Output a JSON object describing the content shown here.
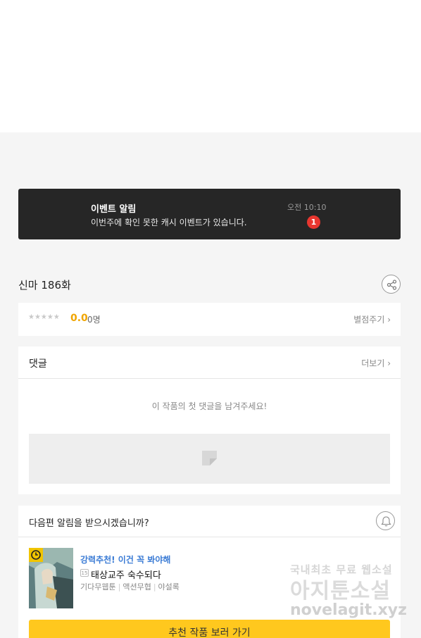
{
  "event": {
    "title": "이벤트 알림",
    "desc": "이번주에 확인 못한 캐시 이벤트가 있습니다.",
    "time": "오전 10:10",
    "badge": "1"
  },
  "episode": {
    "title": "신마 186화"
  },
  "rating": {
    "stars": "★★★★★",
    "score": "0.0",
    "count": "0명",
    "action": "별점주기 ›",
    "value": 0.0
  },
  "comments": {
    "title": "댓글",
    "more": "더보기 ›",
    "empty_text": "이 작품의 첫 댓글을 남겨주세요!"
  },
  "notify": {
    "question": "다음편 알림을 받으시겠습니까?",
    "rec_tag": "강력추천! 이건 꼭 봐야해",
    "age_badge": "15",
    "work_title": "태상교주 숙수되다",
    "meta_1": "기다무웹툰",
    "meta_2": "액션무협",
    "meta_3": "야설록",
    "cta": "추천 작품 보러 가기"
  },
  "watermark": {
    "line1": "국내최초 무료 웹소설",
    "line2": "아지툰소설",
    "line3": "novelagit.xyz"
  },
  "colors": {
    "accent": "#ffc81e",
    "score": "#f0a500",
    "badge": "#e8362f",
    "link_blue": "#3a7bd5"
  }
}
